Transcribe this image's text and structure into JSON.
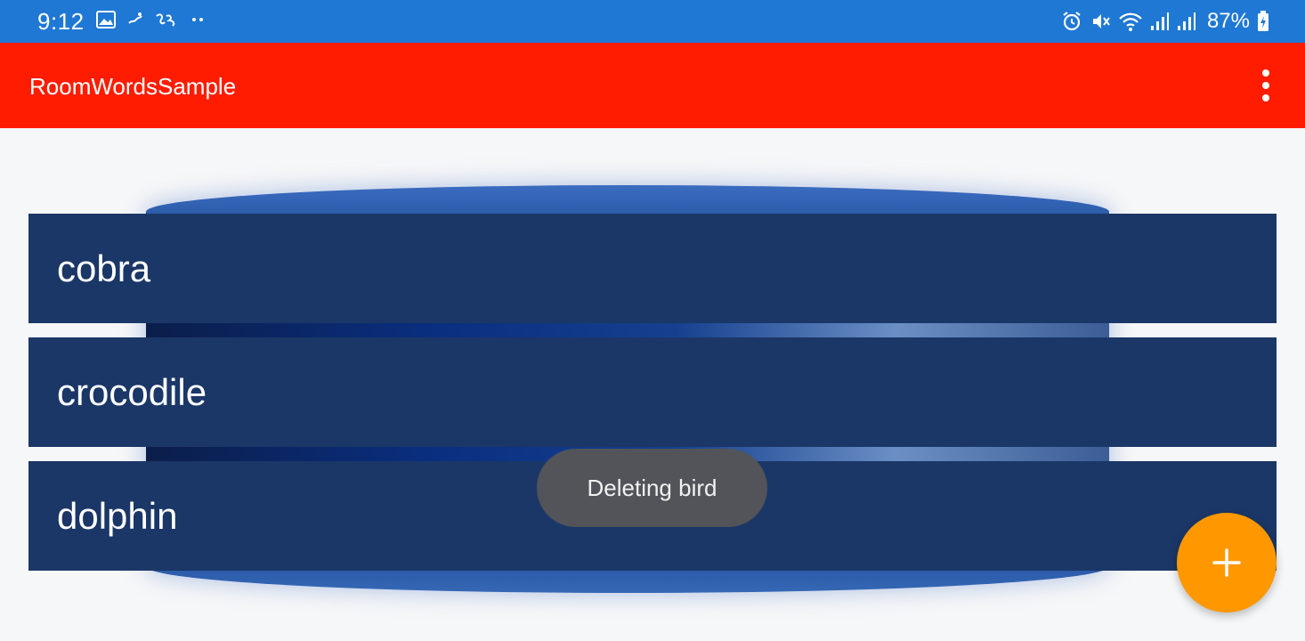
{
  "status_bar": {
    "time": "9:12",
    "battery_text": "87%",
    "left_icons": [
      "image-icon",
      "notification-icon",
      "bengali-app-icon",
      "more-notifications-icon"
    ],
    "right_icons": [
      "alarm-icon",
      "vibrate-icon",
      "wifi-icon",
      "signal-icon",
      "signal-icon",
      "battery-charging-icon"
    ],
    "color": "#1e78d4"
  },
  "app_bar": {
    "title": "RoomWordsSample",
    "menu_icon": "more-vert-icon",
    "color": "#ff1c00"
  },
  "word_list": {
    "items": [
      {
        "word": "cobra"
      },
      {
        "word": "crocodile"
      },
      {
        "word": "dolphin"
      }
    ],
    "item_color": "#1b3767"
  },
  "toast": {
    "message": "Deleting bird"
  },
  "fab": {
    "icon": "add-icon",
    "color": "#ff9800"
  }
}
